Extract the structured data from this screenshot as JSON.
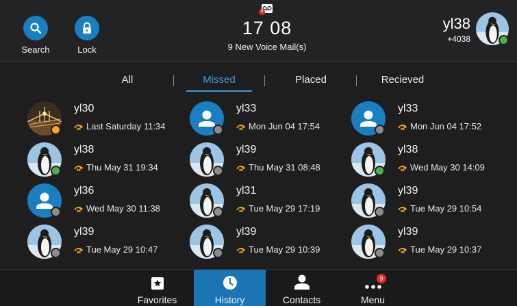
{
  "header": {
    "search_label": "Search",
    "lock_label": "Lock",
    "time": "17 08",
    "voicemail_text": "9 New Voice Mail(s)",
    "voicemail_count": "9",
    "account_name": "yl38",
    "account_number": "+4038"
  },
  "tabs": [
    "All",
    "Missed",
    "Placed",
    "Recieved"
  ],
  "active_tab": "Missed",
  "entries": [
    {
      "name": "yl30",
      "time": "Last Saturday 11:34",
      "avatar": "city",
      "status": "away"
    },
    {
      "name": "yl33",
      "time": "Mon Jun 04 17:54",
      "avatar": "default",
      "status": "off"
    },
    {
      "name": "yl33",
      "time": "Mon Jun 04 17:52",
      "avatar": "default",
      "status": "off"
    },
    {
      "name": "yl38",
      "time": "Thu May 31 19:34",
      "avatar": "penguin",
      "status": "ok"
    },
    {
      "name": "yl39",
      "time": "Thu May 31 08:48",
      "avatar": "penguin",
      "status": "off"
    },
    {
      "name": "yl38",
      "time": "Wed May 30 14:09",
      "avatar": "penguin",
      "status": "ok"
    },
    {
      "name": "yl36",
      "time": "Wed May 30 11:38",
      "avatar": "default",
      "status": "off"
    },
    {
      "name": "yl31",
      "time": "Tue May 29 17:19",
      "avatar": "penguin",
      "status": "off"
    },
    {
      "name": "yl39",
      "time": "Tue May 29 10:54",
      "avatar": "penguin",
      "status": "off"
    },
    {
      "name": "yl39",
      "time": "Tue May 29 10:47",
      "avatar": "penguin",
      "status": "off"
    },
    {
      "name": "yl39",
      "time": "Tue May 29 10:39",
      "avatar": "penguin",
      "status": "off"
    },
    {
      "name": "yl39",
      "time": "Tue May 29 10:37",
      "avatar": "penguin",
      "status": "off"
    }
  ],
  "footer": {
    "favorites_label": "Favorites",
    "history_label": "History",
    "contacts_label": "Contacts",
    "menu_label": "Menu",
    "menu_badge": "9"
  },
  "colors": {
    "accent": "#3a9ad9",
    "button_blue": "#1a7fc1",
    "missed_call": "#f5a623",
    "status_ok": "#4caf50",
    "status_off": "#8d8d8d",
    "badge_red": "#e32b2b"
  }
}
